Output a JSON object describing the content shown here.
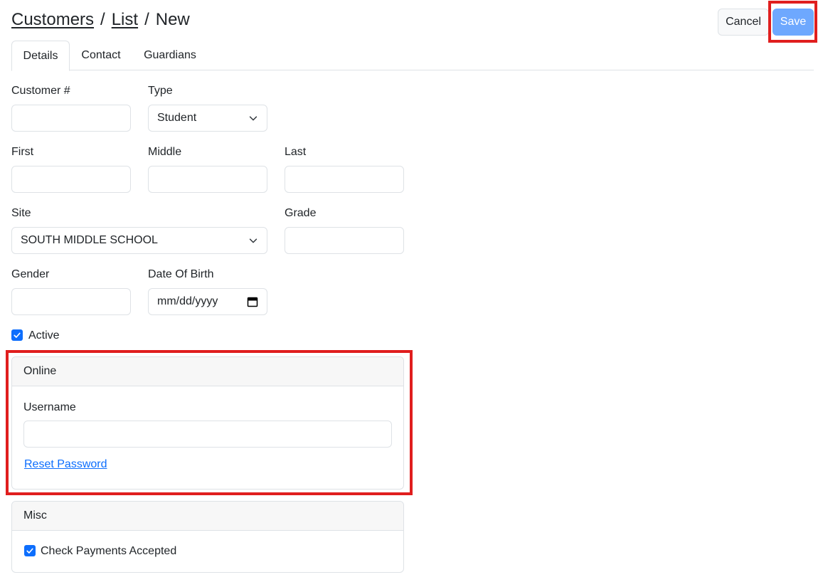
{
  "breadcrumb": {
    "items": [
      "Customers",
      "List"
    ],
    "current": "New",
    "separator": "/"
  },
  "actions": {
    "cancel_label": "Cancel",
    "save_label": "Save"
  },
  "tabs": [
    {
      "label": "Details",
      "active": true
    },
    {
      "label": "Contact"
    },
    {
      "label": "Guardians"
    }
  ],
  "form": {
    "customer_number": {
      "label": "Customer #",
      "value": ""
    },
    "type": {
      "label": "Type",
      "value": "Student"
    },
    "first": {
      "label": "First",
      "value": ""
    },
    "middle": {
      "label": "Middle",
      "value": ""
    },
    "last": {
      "label": "Last",
      "value": ""
    },
    "site": {
      "label": "Site",
      "value": "SOUTH MIDDLE SCHOOL"
    },
    "grade": {
      "label": "Grade",
      "value": ""
    },
    "gender": {
      "label": "Gender",
      "value": ""
    },
    "dob": {
      "label": "Date Of Birth",
      "placeholder": "mm/dd/yyyy"
    },
    "active": {
      "label": "Active",
      "checked": true
    }
  },
  "online": {
    "title": "Online",
    "username_label": "Username",
    "username_value": "",
    "reset_link": "Reset Password"
  },
  "misc": {
    "title": "Misc",
    "check_payments_label": "Check Payments Accepted",
    "checked": true
  },
  "colors": {
    "primary": "#0d6efd",
    "save_button": "#6ea8fe",
    "highlight": "#e01e1e"
  }
}
